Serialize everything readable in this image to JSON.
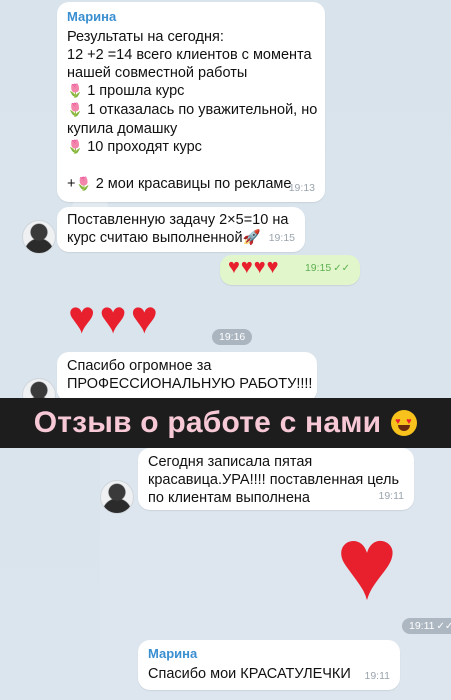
{
  "messages": [
    {
      "sender": "Марина",
      "lines": [
        "Результаты на сегодня:",
        "12 +2 =14 всего клиентов с момента",
        "нашей совместной работы",
        "1 прошла курс",
        "1 отказалась по уважительной, но",
        "купила домашку",
        "10 проходят курс",
        "",
        "2  мои красавицы по рекламе"
      ],
      "time": "19:13"
    },
    {
      "lines": [
        "Поставленную задачу 2×5=10 на",
        "курс считаю выполненной🚀"
      ],
      "time": "19:15"
    },
    {
      "hearts": 4,
      "time": "19:15"
    },
    {
      "hearts": 3,
      "time": "19:16"
    },
    {
      "lines": [
        "Спасибо огромное за",
        "ПРОФЕССИОНАЛЬНУЮ  РАБОТУ!!!!"
      ],
      "time": ""
    },
    {
      "lines": [
        "Сегодня записала пятая",
        "красавица.УРА!!!! поставленная цель",
        "по клиентам выполнена"
      ],
      "time": "19:11"
    },
    {
      "hearts": 1,
      "time": "19:11"
    },
    {
      "sender": "Марина",
      "lines": [
        "Спасибо мои  КРАСАТУЛЕЧКИ"
      ],
      "time": "19:11"
    }
  ],
  "banner": {
    "text": "Отзыв  о работе с нами"
  },
  "colors": {
    "heart": "#e8202e",
    "banner_text": "#f7c9d6",
    "sender": "#3a8fd0",
    "own_bubble": "#e1f7cb"
  },
  "icons": {
    "flower": "tulip-icon",
    "read": "double-check-icon",
    "rocket": "rocket-icon",
    "heart_eyes": "heart-eyes-emoji"
  }
}
